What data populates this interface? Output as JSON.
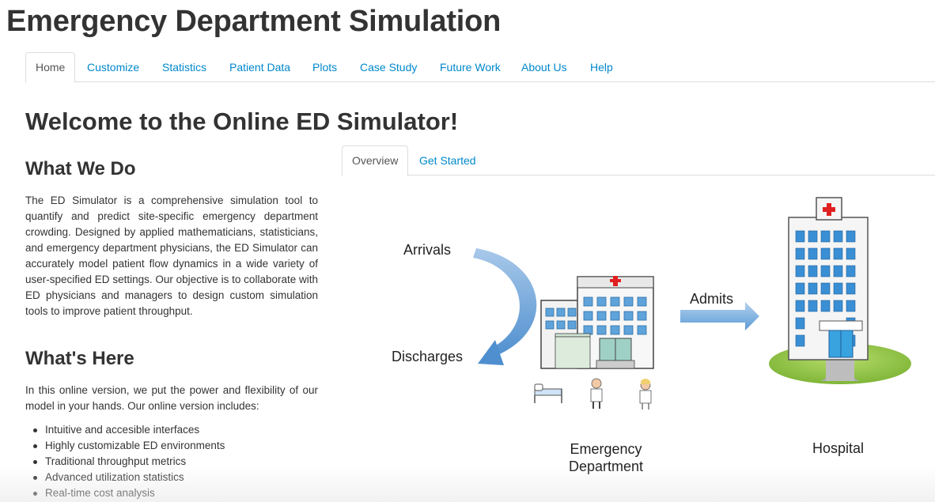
{
  "app": {
    "title": "Emergency Department Simulation"
  },
  "main_nav": {
    "tabs": [
      {
        "label": "Home",
        "active": true
      },
      {
        "label": "Customize"
      },
      {
        "label": "Statistics"
      },
      {
        "label": "Patient Data"
      },
      {
        "label": "Plots"
      },
      {
        "label": "Case Study"
      },
      {
        "label": "Future Work"
      },
      {
        "label": "About Us"
      },
      {
        "label": "Help"
      }
    ]
  },
  "page": {
    "heading": "Welcome to the Online ED Simulator!",
    "what_we_do": {
      "heading": "What We Do",
      "text": "The ED Simulator is a comprehensive simulation tool to quantify and predict site-specific emergency department crowding. Designed by applied mathematicians, statisticians, and emergency department physicians, the ED Simulator can accurately model patient flow dynamics in a wide variety of user-specified ED settings. Our objective is to collaborate with ED physicians and managers to design custom simulation tools to improve patient throughput."
    },
    "whats_here": {
      "heading": "What's Here",
      "text": "In this online version, we put the power and flexibility of our model in your hands. Our online version includes:",
      "items": [
        "Intuitive and accesible interfaces",
        "Highly customizable ED environments",
        "Traditional throughput metrics",
        "Advanced utilization statistics",
        "Real-time cost analysis"
      ]
    }
  },
  "sub_nav": {
    "tabs": [
      {
        "label": "Overview",
        "active": true
      },
      {
        "label": "Get Started"
      }
    ]
  },
  "diagram": {
    "arrivals": "Arrivals",
    "discharges": "Discharges",
    "admits": "Admits",
    "ed_line1": "Emergency",
    "ed_line2": "Department",
    "hospital": "Hospital"
  },
  "colors": {
    "link": "#0088cc",
    "text": "#333333",
    "arrow": "#5b9bd5",
    "cross": "#e02020",
    "grass": "#8cc63f"
  }
}
